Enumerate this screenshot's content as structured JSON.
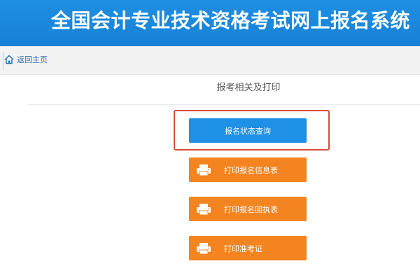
{
  "header": {
    "title": "全国会计专业技术资格考试网上报名系统"
  },
  "nav": {
    "home_label": "返回主页"
  },
  "section": {
    "title": "报考相关及打印"
  },
  "buttons": {
    "status_query": "报名状态查询",
    "print_info": "打印报名信息表",
    "print_receipt": "打印报名回执表",
    "print_admission": "打印准考证"
  },
  "colors": {
    "header_blue": "#1681d6",
    "primary_button": "#1e90e6",
    "orange_button": "#f48420",
    "highlight_border": "#d64b3d"
  },
  "icons": {
    "home": "home-icon",
    "printer": "printer-icon"
  }
}
